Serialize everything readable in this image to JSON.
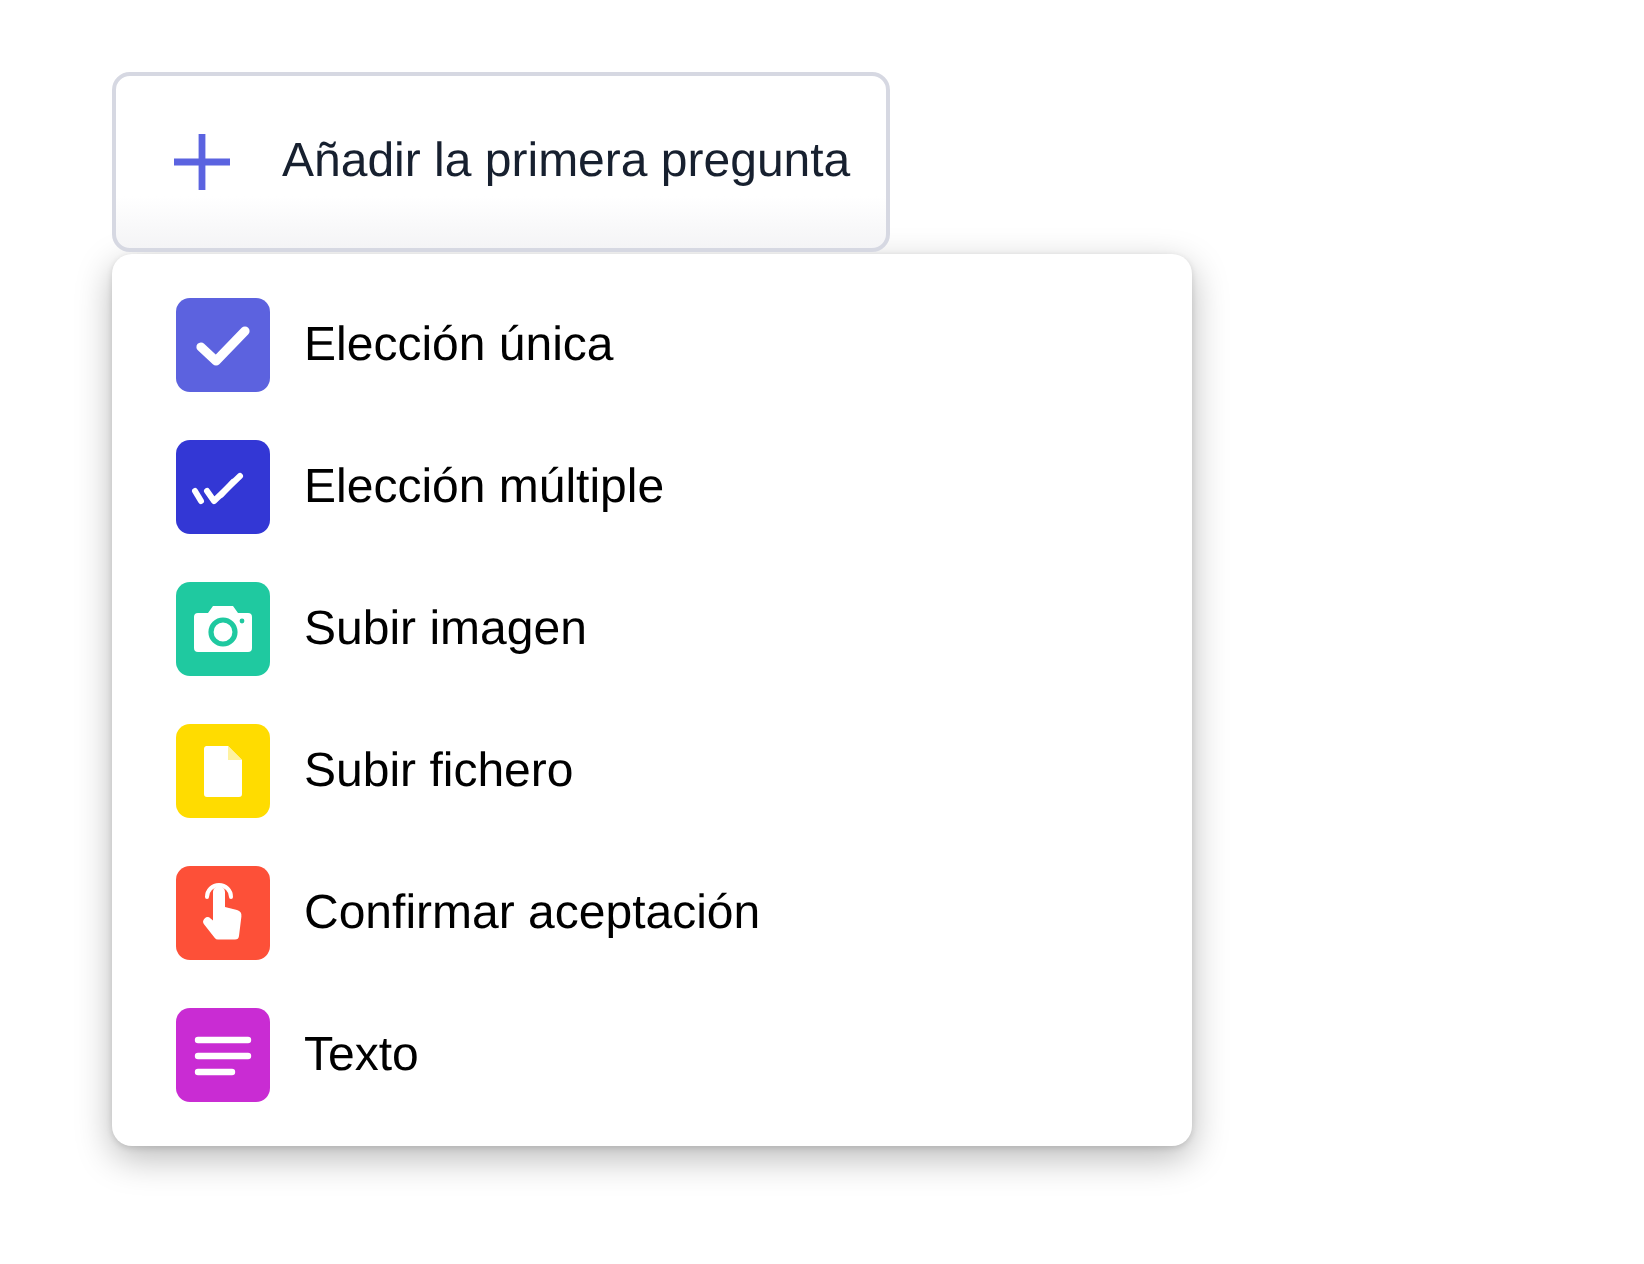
{
  "add_button": {
    "label": "Añadir la primera pregunta"
  },
  "menu": {
    "items": [
      {
        "kind": "single",
        "label": "Elección única",
        "color": "#5c62df"
      },
      {
        "kind": "multiple",
        "label": "Elección múltiple",
        "color": "#3337d5"
      },
      {
        "kind": "image",
        "label": "Subir imagen",
        "color": "#1fc9a0"
      },
      {
        "kind": "file",
        "label": "Subir fichero",
        "color": "#ffdc00"
      },
      {
        "kind": "confirm",
        "label": "Confirmar aceptación",
        "color": "#fd5038"
      },
      {
        "kind": "text",
        "label": "Texto",
        "color": "#c92cd3"
      }
    ]
  }
}
